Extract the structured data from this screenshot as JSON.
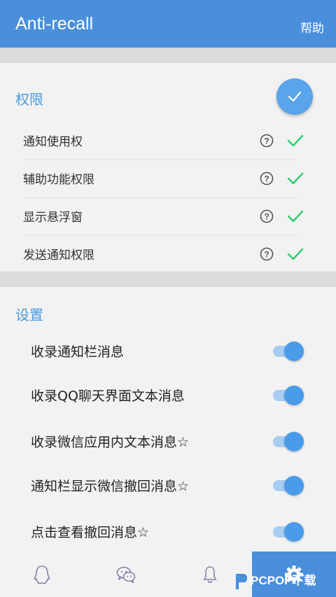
{
  "app": {
    "title": "Anti-recall",
    "help_label": "帮助"
  },
  "permissions": {
    "title": "权限",
    "items": [
      {
        "label": "通知使用权"
      },
      {
        "label": "辅助功能权限"
      },
      {
        "label": "显示悬浮窗"
      },
      {
        "label": "发送通知权限"
      }
    ]
  },
  "settings": {
    "title": "设置",
    "items": [
      {
        "label": "收录通知栏消息",
        "enabled": true
      },
      {
        "label": "收录QQ聊天界面文本消息",
        "enabled": true
      },
      {
        "label": "收录微信应用内文本消息☆",
        "enabled": true
      },
      {
        "label": "通知栏显示微信撤回消息☆",
        "enabled": true
      },
      {
        "label": "点击查看撤回消息☆",
        "enabled": true
      }
    ]
  },
  "nav": {
    "items": [
      {
        "icon": "qq-penguin-icon"
      },
      {
        "icon": "wechat-icon"
      },
      {
        "icon": "bell-icon"
      },
      {
        "icon": "settings-gear-icon",
        "active": true
      }
    ]
  },
  "colors": {
    "primary": "#4a8fdb",
    "accent": "#5aa4ec",
    "check": "#2ecc71",
    "background": "#f2f2f2"
  },
  "watermark": {
    "text": "PCPOP下载"
  }
}
